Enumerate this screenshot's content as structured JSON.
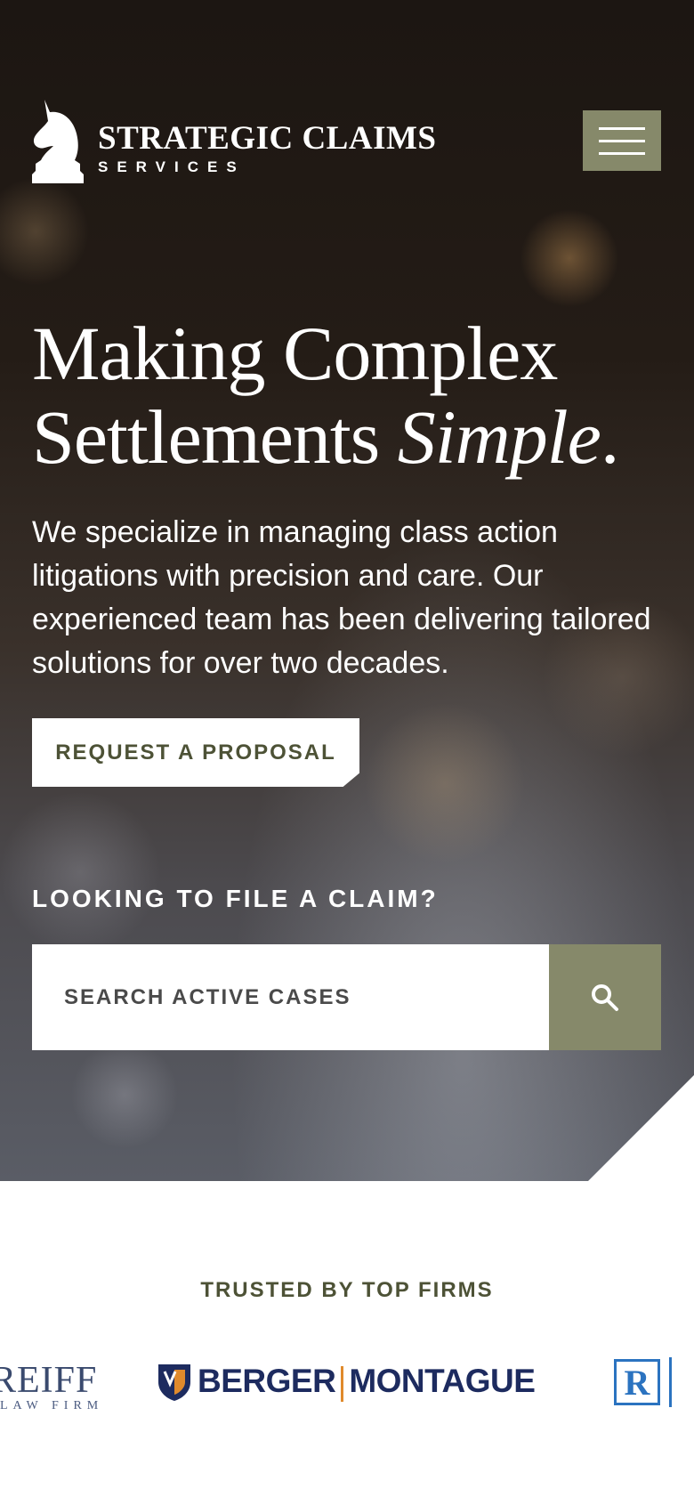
{
  "brand": {
    "name": "STRATEGIC CLAIMS",
    "tagline": "SERVICES"
  },
  "header": {
    "menu_icon": "hamburger-menu-icon"
  },
  "hero": {
    "headline_line1": "Making Complex",
    "headline_line2_plain": "Settlements ",
    "headline_line2_italic": "Simple",
    "headline_period": ".",
    "intro": "We specialize in managing class action litigations with precision and care. Our experienced team has been delivering tailored solutions for over two decades.",
    "proposal_button": "REQUEST A PROPOSAL"
  },
  "claim_search": {
    "label": "LOOKING TO FILE A CLAIM?",
    "placeholder": "SEARCH ACTIVE CASES",
    "value": "",
    "search_icon": "search-icon"
  },
  "trusted": {
    "label": "TRUSTED BY TOP FIRMS",
    "logos": [
      {
        "name": "REIFF",
        "sub": "LAW FIRM"
      },
      {
        "part1": "BERGER",
        "part2": "MONTAGUE"
      },
      {
        "letter": "R"
      }
    ]
  },
  "colors": {
    "accent": "#86896a",
    "accent_text": "#4d5236",
    "white": "#ffffff"
  }
}
